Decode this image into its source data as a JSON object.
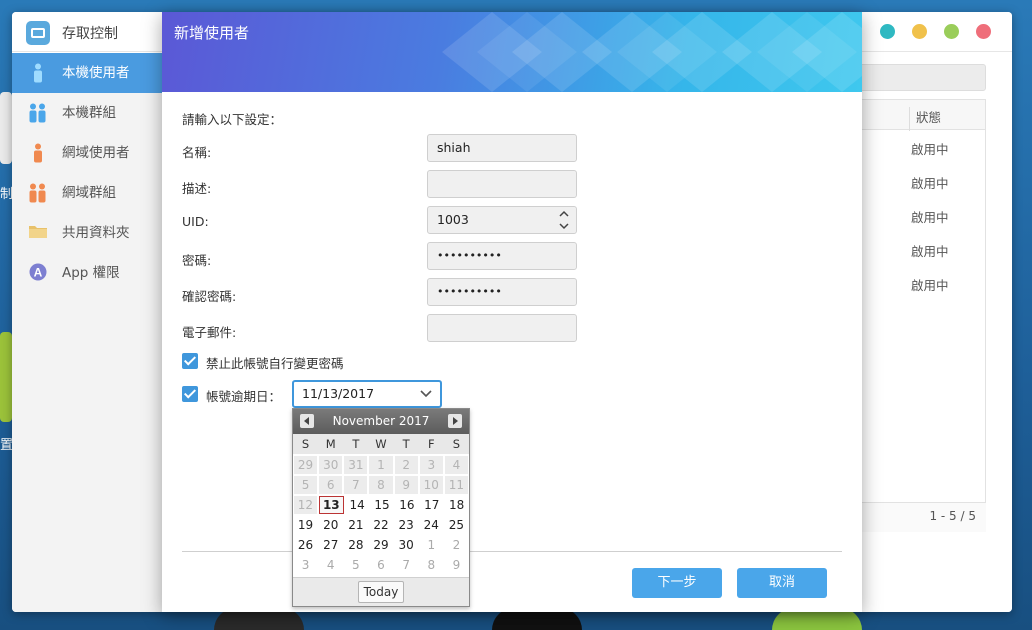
{
  "desktop": {
    "side_labels": [
      "制",
      "置"
    ]
  },
  "background_window": {
    "app_title": "存取控制",
    "window_dots": [
      "#2fb9c2",
      "#f0c14b",
      "#9acd5a",
      "#ef6e7a"
    ],
    "sidebar": {
      "items": [
        {
          "label": "本機使用者",
          "icon": "person-icon",
          "active": true
        },
        {
          "label": "本機群組",
          "icon": "group-icon",
          "active": false
        },
        {
          "label": "網域使用者",
          "icon": "domain-user-icon",
          "active": false
        },
        {
          "label": "網域群組",
          "icon": "domain-group-icon",
          "active": false
        },
        {
          "label": "共用資料夾",
          "icon": "folder-icon",
          "active": false
        },
        {
          "label": "App 權限",
          "icon": "app-icon",
          "active": false
        }
      ]
    },
    "table": {
      "status_header": "狀態",
      "rows": [
        "啟用中",
        "啟用中",
        "啟用中",
        "啟用中",
        "啟用中"
      ],
      "pagination": "1 - 5 / 5"
    }
  },
  "dialog": {
    "title": "新增使用者",
    "prompt": "請輸入以下設定：",
    "fields": {
      "name_label": "名稱:",
      "name_value": "shiah",
      "description_label": "描述:",
      "description_value": "",
      "uid_label": "UID:",
      "uid_value": "1003",
      "password_label": "密碼:",
      "password_value": "••••••••••",
      "confirm_label": "確認密碼:",
      "confirm_value": "••••••••••",
      "email_label": "電子郵件:",
      "email_value": ""
    },
    "disallow_pwd_change": {
      "label": "禁止此帳號自行變更密碼",
      "checked": true
    },
    "expiration": {
      "label": "帳號逾期日：",
      "checked": true,
      "value": "11/13/2017"
    },
    "buttons": {
      "next": "下一步",
      "cancel": "取消"
    }
  },
  "calendar": {
    "month_label": "November 2017",
    "weekdays": [
      "S",
      "M",
      "T",
      "W",
      "T",
      "F",
      "S"
    ],
    "weeks": [
      [
        {
          "d": "29",
          "s": "disabled"
        },
        {
          "d": "30",
          "s": "disabled"
        },
        {
          "d": "31",
          "s": "disabled"
        },
        {
          "d": "1",
          "s": "disabled"
        },
        {
          "d": "2",
          "s": "disabled"
        },
        {
          "d": "3",
          "s": "disabled"
        },
        {
          "d": "4",
          "s": "disabled"
        }
      ],
      [
        {
          "d": "5",
          "s": "disabled"
        },
        {
          "d": "6",
          "s": "disabled"
        },
        {
          "d": "7",
          "s": "disabled"
        },
        {
          "d": "8",
          "s": "disabled"
        },
        {
          "d": "9",
          "s": "disabled"
        },
        {
          "d": "10",
          "s": "disabled"
        },
        {
          "d": "11",
          "s": "disabled"
        }
      ],
      [
        {
          "d": "12",
          "s": "disabled"
        },
        {
          "d": "13",
          "s": "sel"
        },
        {
          "d": "14",
          "s": ""
        },
        {
          "d": "15",
          "s": ""
        },
        {
          "d": "16",
          "s": ""
        },
        {
          "d": "17",
          "s": ""
        },
        {
          "d": "18",
          "s": ""
        }
      ],
      [
        {
          "d": "19",
          "s": ""
        },
        {
          "d": "20",
          "s": ""
        },
        {
          "d": "21",
          "s": ""
        },
        {
          "d": "22",
          "s": ""
        },
        {
          "d": "23",
          "s": ""
        },
        {
          "d": "24",
          "s": ""
        },
        {
          "d": "25",
          "s": ""
        }
      ],
      [
        {
          "d": "26",
          "s": ""
        },
        {
          "d": "27",
          "s": ""
        },
        {
          "d": "28",
          "s": ""
        },
        {
          "d": "29",
          "s": ""
        },
        {
          "d": "30",
          "s": ""
        },
        {
          "d": "1",
          "s": "out"
        },
        {
          "d": "2",
          "s": "out"
        }
      ],
      [
        {
          "d": "3",
          "s": "out"
        },
        {
          "d": "4",
          "s": "out"
        },
        {
          "d": "5",
          "s": "out"
        },
        {
          "d": "6",
          "s": "out"
        },
        {
          "d": "7",
          "s": "out"
        },
        {
          "d": "8",
          "s": "out"
        },
        {
          "d": "9",
          "s": "out"
        }
      ]
    ],
    "today_label": "Today"
  }
}
